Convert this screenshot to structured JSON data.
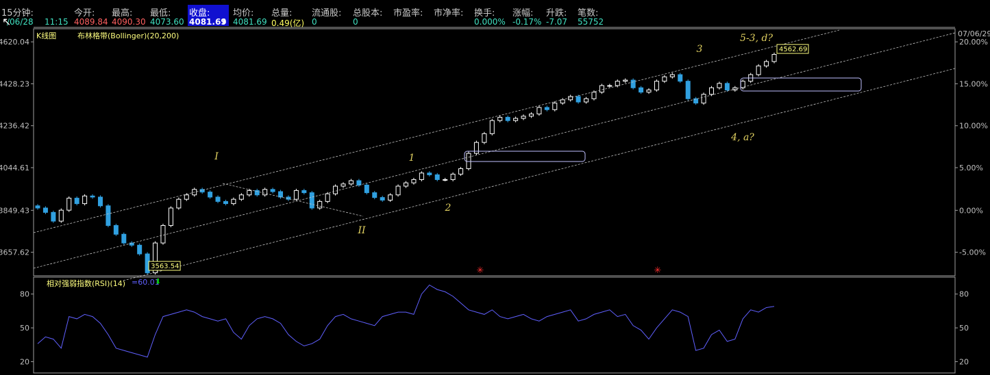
{
  "header": {
    "period": "15分钟:",
    "date": "/06/28",
    "time": "11:15",
    "open_label": "今开:",
    "open": "4089.84",
    "high_label": "最高:",
    "high": "4090.30",
    "low_label": "最低:",
    "low": "4073.60",
    "close_label": "收盘:",
    "close": "4081.69",
    "avg_label": "均价:",
    "avg": "4081.69",
    "vol_label": "总量:",
    "vol": "0.49(亿)",
    "float_label": "流通股:",
    "float": "0",
    "total_label": "总股本:",
    "total": "0",
    "pe_label": "市盈率:",
    "pb_label": "市净率:",
    "turn_label": "换手:",
    "turn": "0.000%",
    "chg_label": "涨幅:",
    "chg": "-0.17%",
    "updown_label": "升跌:",
    "updown": "-7.07",
    "trades_label": "笔数:",
    "trades": "55752"
  },
  "legend": {
    "kline": "K线图",
    "boll": "布林格带(Bollinger)(20,200)",
    "rsi": "相对强弱指数(RSI)(14)",
    "rsi_value": "=60.01"
  },
  "colors": {
    "up": "#ffffff",
    "down": "#30a0e0",
    "rsi_line": "#6060ff",
    "wave_label": "#e0d060",
    "channel": "#c0c0c0",
    "positive": "#ff6060",
    "neutral": "#40e0c0",
    "close_box": "#1010d0",
    "axis_marker": "#ffff80"
  },
  "chart_data": {
    "type": "candlestick",
    "y_axis_left": [
      "4620.04",
      "4428.23",
      "4236.42",
      "4044.61",
      "3849.43",
      "3657.62"
    ],
    "y_axis_right": [
      "20.00%",
      "15.00%",
      "10.00%",
      "5.00%",
      "0.00%",
      "-5.00%"
    ],
    "right_top_date": "07/06/29",
    "ylim": [
      3550,
      4680
    ],
    "price_series": [
      3860,
      3840,
      3800,
      3850,
      3905,
      3880,
      3915,
      3910,
      3870,
      3780,
      3740,
      3700,
      3690,
      3650,
      3563.54,
      3700,
      3780,
      3860,
      3900,
      3920,
      3945,
      3933,
      3910,
      3890,
      3880,
      3900,
      3920,
      3940,
      3920,
      3945,
      3935,
      3910,
      3900,
      3940,
      3930,
      3860,
      3890,
      3925,
      3960,
      3970,
      3985,
      3965,
      3930,
      3908,
      3896,
      3920,
      3960,
      3975,
      3990,
      4020,
      4012,
      3990,
      3990,
      4015,
      4040,
      4110,
      4160,
      4200,
      4260,
      4275,
      4260,
      4270,
      4280,
      4290,
      4320,
      4310,
      4340,
      4355,
      4370,
      4345,
      4360,
      4390,
      4420,
      4420,
      4440,
      4445,
      4410,
      4390,
      4400,
      4440,
      4460,
      4470,
      4440,
      4360,
      4340,
      4380,
      4410,
      4430,
      4400,
      4410,
      4440,
      4470,
      4510,
      4530,
      4562.69
    ],
    "annotations": {
      "low_marker": "3563.54",
      "high_marker": "4562.69",
      "waves": [
        "I",
        "II",
        "1",
        "2",
        "3",
        "4, a?",
        "5-3, d?"
      ]
    },
    "rsi": {
      "y_axis": [
        "80",
        "50",
        "20"
      ],
      "ylim": [
        10,
        95
      ],
      "values": [
        36,
        42,
        40,
        32,
        60,
        58,
        62,
        60,
        54,
        44,
        32,
        30,
        28,
        26,
        24,
        44,
        60,
        62,
        64,
        66,
        64,
        60,
        58,
        56,
        58,
        46,
        40,
        52,
        58,
        60,
        58,
        54,
        44,
        38,
        34,
        36,
        40,
        52,
        60,
        62,
        58,
        56,
        54,
        52,
        60,
        62,
        64,
        64,
        62,
        80,
        88,
        84,
        82,
        78,
        72,
        66,
        64,
        62,
        66,
        60,
        58,
        60,
        62,
        58,
        56,
        60,
        62,
        64,
        66,
        56,
        58,
        62,
        64,
        66,
        60,
        62,
        52,
        48,
        40,
        50,
        58,
        66,
        64,
        60,
        30,
        32,
        44,
        48,
        38,
        40,
        58,
        66,
        64,
        68,
        69
      ],
      "current": "60.01"
    }
  }
}
